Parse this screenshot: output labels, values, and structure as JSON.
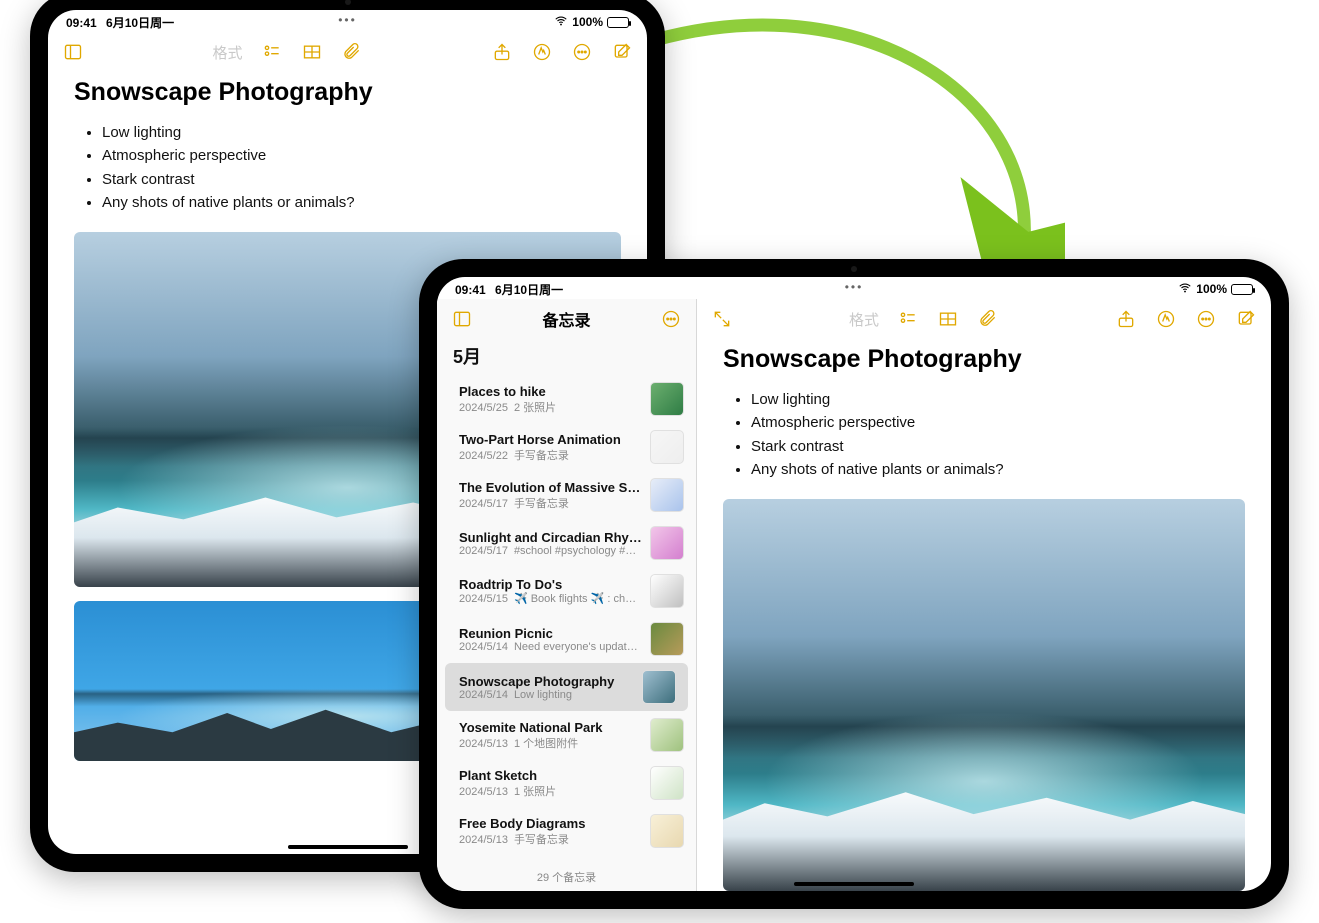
{
  "status": {
    "time": "09:41",
    "date": "6月10日周一",
    "battery_pct": "100%"
  },
  "toolbar": {
    "format_label": "格式"
  },
  "note": {
    "title": "Snowscape Photography",
    "bullets": [
      "Low lighting",
      "Atmospheric perspective",
      "Stark contrast",
      "Any shots of native plants or animals?"
    ]
  },
  "sidebar": {
    "title": "备忘录",
    "month": "5月",
    "footer": "29 个备忘录",
    "items": [
      {
        "title": "Places to hike",
        "date": "2024/5/25",
        "sub": "2 张照片",
        "c1": "#6caf6f",
        "c2": "#2f7d45"
      },
      {
        "title": "Two-Part Horse Animation",
        "date": "2024/5/22",
        "sub": "手写备忘录",
        "c1": "#f6f6f6",
        "c2": "#eeeeee"
      },
      {
        "title": "The Evolution of Massive Star…",
        "date": "2024/5/17",
        "sub": "手写备忘录",
        "c1": "#e7edf8",
        "c2": "#a9c3ec"
      },
      {
        "title": "Sunlight and Circadian Rhyth…",
        "date": "2024/5/17",
        "sub": "#school #psychology #…",
        "c1": "#f2c6e9",
        "c2": "#d47fcf"
      },
      {
        "title": "Roadtrip To Do's",
        "date": "2024/5/15",
        "sub": "✈️ Book flights ✈️ : che…",
        "c1": "#ffffff",
        "c2": "#c0c0c0"
      },
      {
        "title": "Reunion Picnic",
        "date": "2024/5/14",
        "sub": "Need everyone's updat…",
        "c1": "#6a8a3f",
        "c2": "#b79b5a"
      },
      {
        "title": "Snowscape Photography",
        "date": "2024/5/14",
        "sub": "Low lighting",
        "c1": "#9fbfd0",
        "c2": "#3d6e7c",
        "selected": true
      },
      {
        "title": "Yosemite National Park",
        "date": "2024/5/13",
        "sub": "1 个地图附件",
        "c1": "#dfeccd",
        "c2": "#9fc27e"
      },
      {
        "title": "Plant Sketch",
        "date": "2024/5/13",
        "sub": "1 张照片",
        "c1": "#ffffff",
        "c2": "#cfe3c6"
      },
      {
        "title": "Free Body Diagrams",
        "date": "2024/5/13",
        "sub": "手写备忘录",
        "c1": "#f8f0d8",
        "c2": "#e8d8b0"
      }
    ]
  }
}
